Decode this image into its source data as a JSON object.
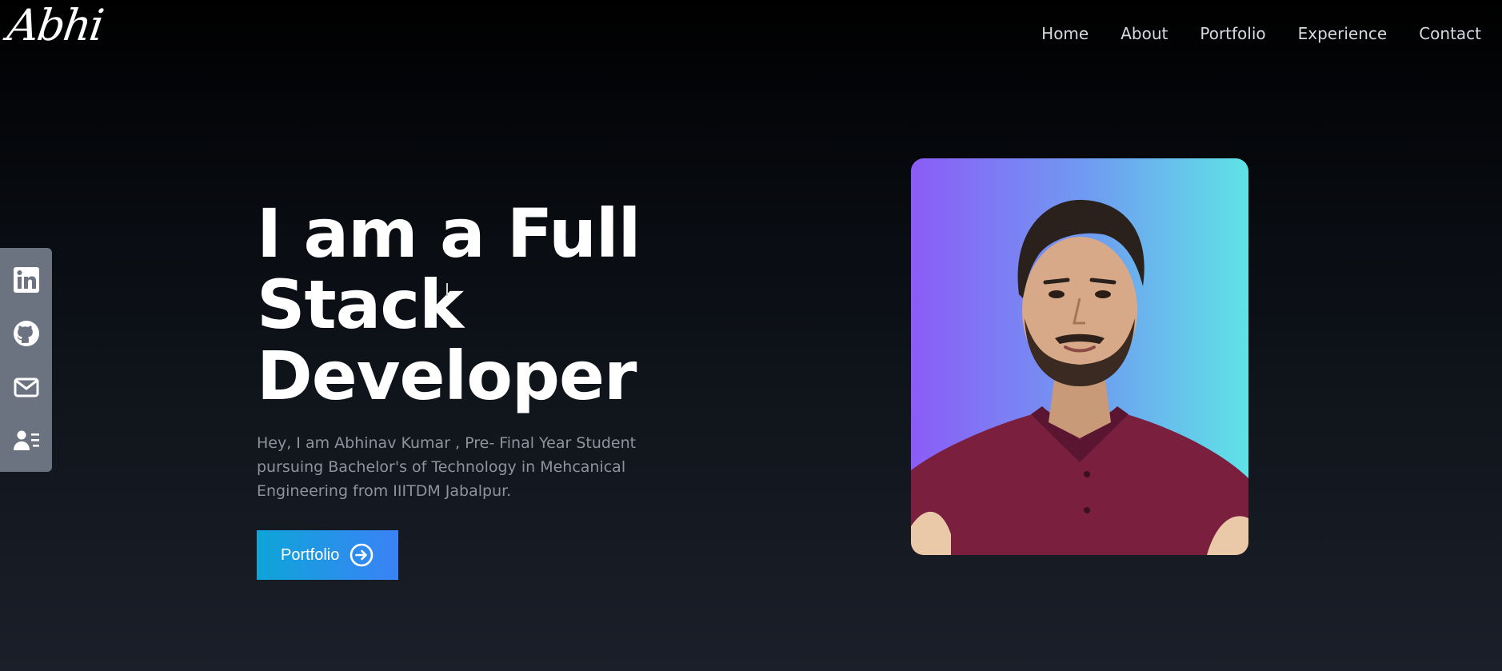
{
  "logo": {
    "text": "Abhi"
  },
  "nav": {
    "items": [
      {
        "label": "Home"
      },
      {
        "label": "About"
      },
      {
        "label": "Portfolio"
      },
      {
        "label": "Experience"
      },
      {
        "label": "Contact"
      }
    ]
  },
  "social": {
    "items": [
      {
        "icon": "linkedin-icon"
      },
      {
        "icon": "github-icon"
      },
      {
        "icon": "mail-icon"
      },
      {
        "icon": "resume-icon"
      }
    ]
  },
  "hero": {
    "title_line1": "I am a Full Stack",
    "title_line2": "Developer",
    "description": "Hey, I am Abhinav Kumar , Pre- Final Year Student pursuing Bachelor's of Technology in Mehcanical Engineering from IIITDM Jabalpur.",
    "cta_label": "Portfolio",
    "cta_icon": "arrow-right-circle-icon"
  },
  "profile_photo": {
    "icon": "profile-photo"
  },
  "colors": {
    "accent_start": "#0ea5d8",
    "accent_end": "#3b82f6",
    "photo_bg_start": "#8b5cf6",
    "photo_bg_end": "#5fe3e6",
    "sidebar_bg": "#6b7280"
  }
}
